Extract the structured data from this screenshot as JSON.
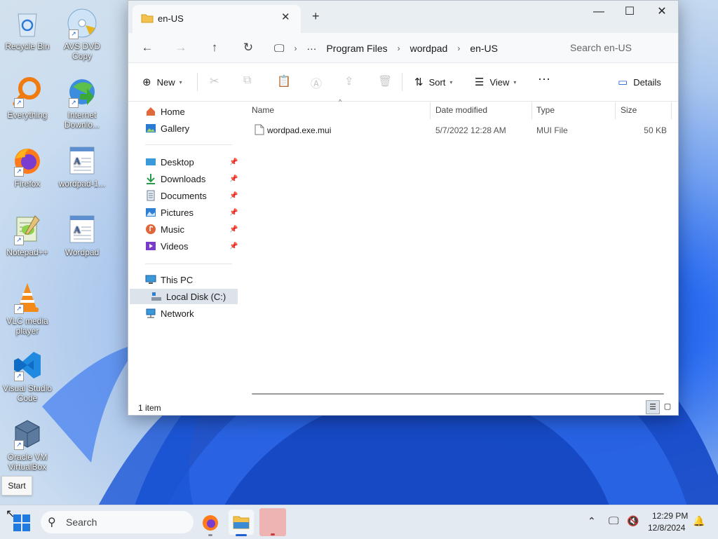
{
  "desktop": {
    "icons": [
      {
        "label": "Recycle Bin",
        "icon": "recycle-bin-icon"
      },
      {
        "label": "AVS DVD Copy",
        "icon": "dvd-icon"
      },
      {
        "label": "Everything",
        "icon": "search-magnifier-icon"
      },
      {
        "label": "Internet Downlo...",
        "icon": "download-manager-icon"
      },
      {
        "label": "Firefox",
        "icon": "firefox-icon"
      },
      {
        "label": "wordpad-1...",
        "icon": "wordpad-icon"
      },
      {
        "label": "Notepad++",
        "icon": "notepadpp-icon"
      },
      {
        "label": "Wordpad",
        "icon": "wordpad-icon"
      },
      {
        "label": "VLC media player",
        "icon": "vlc-icon"
      },
      {
        "label": "Visual Studio Code",
        "icon": "vscode-icon"
      },
      {
        "label": "Oracle VM VirtualBox",
        "icon": "virtualbox-icon"
      }
    ]
  },
  "tooltip": {
    "text": "Start"
  },
  "explorer": {
    "tab_title": "en-US",
    "breadcrumbs": [
      "Program Files",
      "wordpad",
      "en-US"
    ],
    "search_placeholder": "Search en-US",
    "commands": {
      "new": "New",
      "sort": "Sort",
      "view": "View",
      "details": "Details"
    },
    "nav": {
      "home": "Home",
      "gallery": "Gallery",
      "desktop": "Desktop",
      "downloads": "Downloads",
      "documents": "Documents",
      "pictures": "Pictures",
      "music": "Music",
      "videos": "Videos",
      "this_pc": "This PC",
      "local_disk": "Local Disk (C:)",
      "network": "Network"
    },
    "columns": {
      "name": "Name",
      "date": "Date modified",
      "type": "Type",
      "size": "Size"
    },
    "files": [
      {
        "name": "wordpad.exe.mui",
        "date": "5/7/2022 12:28 AM",
        "type": "MUI File",
        "size": "50 KB"
      }
    ],
    "status": "1 item"
  },
  "taskbar": {
    "search_label": "Search",
    "time": "12:29 PM",
    "date": "12/8/2024"
  },
  "colors": {
    "accent": "#1f5fd1",
    "taskbar": "#e4eaf1"
  }
}
